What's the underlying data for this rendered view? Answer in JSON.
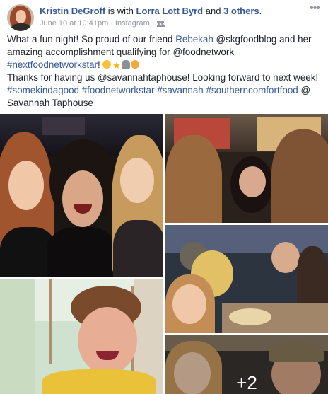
{
  "post": {
    "author": "Kristin DeGroff",
    "with_text": " is with ",
    "tagged_friend": "Lorra Lott Byrd",
    "and_text": " and ",
    "others": "3 others",
    "period": ".",
    "timestamp": "June 10 at 10:41pm",
    "separator": " · ",
    "source": "Instagram",
    "source_suffix": " ·",
    "audience_icon": "friends-icon",
    "more_icon": "more-options-icon",
    "more_glyph": "•••"
  },
  "message": {
    "l1_a": "What a fun night! So proud of our friend ",
    "l1_mention": "Rebekah",
    "l1_b": " @skgfoodblog and her amazing accomplishment qualifying for @foodnetwork",
    "l2_hashtag": "#nextfoodnetworkstar",
    "l2_b": "! ",
    "emojis": [
      "grinning-face-emoji",
      "star-emoji",
      "headphones-emoji",
      "face-emoji"
    ],
    "l3": "Thanks for having us @savannahtaphouse! Looking forward to next week!",
    "tags": [
      "#somekindagood",
      "#foodnetworkstar",
      "#savannah",
      "#southerncomfortfood"
    ],
    "place_at": " @",
    "place": "Savannah Taphouse"
  },
  "photos": {
    "overlay_count": "+2"
  },
  "colors": {
    "link": "#365899",
    "text": "#1d2129",
    "meta": "#90949c"
  }
}
